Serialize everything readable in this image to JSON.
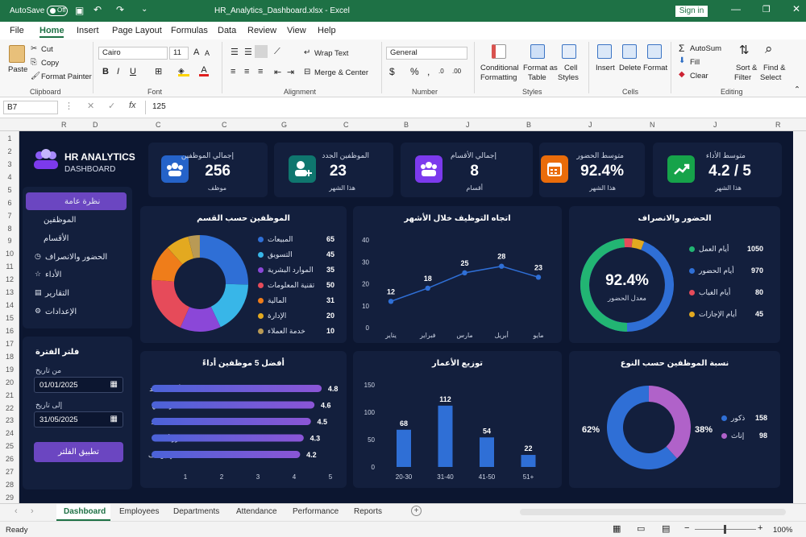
{
  "titlebar": {
    "autosave": "AutoSave",
    "toggle": "Off",
    "title": "HR_Analytics_Dashboard.xlsx  -  Excel",
    "signin": "Sign in"
  },
  "menu": [
    "File",
    "Home",
    "Insert",
    "Page Layout",
    "Formulas",
    "Data",
    "Review",
    "View",
    "Help"
  ],
  "ribbon": {
    "paste": "Paste",
    "cut": "Cut",
    "copy": "Copy",
    "format_painter": "Format Painter",
    "clipboard": "Clipboard",
    "font_name": "Cairo",
    "font_size": "11",
    "font_group": "Font",
    "wrap_text": "Wrap Text",
    "merge_center": "Merge & Center",
    "alignment": "Alignment",
    "number_format": "General",
    "number_group": "Number",
    "conditional_formatting": [
      "Conditional",
      "Formatting"
    ],
    "format_as_table": [
      "Format as",
      "Table"
    ],
    "cell_styles": [
      "Cell",
      "Styles"
    ],
    "styles_group": "Styles",
    "insert": "Insert",
    "delete": "Delete",
    "format": "Format",
    "cells_group": "Cells",
    "autosum": "AutoSum",
    "fill": "Fill",
    "clear": "Clear",
    "sort_filter": [
      "Sort &",
      "Filter"
    ],
    "find_select": [
      "Find &",
      "Select"
    ],
    "editing_group": "Editing"
  },
  "formula_bar": {
    "cell_ref": "B7",
    "fx": "fx",
    "value": "125"
  },
  "columns": [
    "R",
    "D",
    "C",
    "C",
    "G",
    "C",
    "B",
    "J",
    "B",
    "J",
    "N",
    "J",
    "R"
  ],
  "rows": [
    "1",
    "2",
    "3",
    "4",
    "5",
    "6",
    "7",
    "8",
    "9",
    "10",
    "11",
    "12",
    "13",
    "14",
    "15",
    "16",
    "17",
    "18",
    "19",
    "20",
    "21",
    "22",
    "23",
    "24",
    "25",
    "26",
    "27",
    "28",
    "29"
  ],
  "dashboard": {
    "brand_title": "HR ANALYTICS",
    "brand_sub": "DASHBOARD",
    "nav": [
      "نظرة عامة",
      "الموظفين",
      "الأقسام",
      "الحضور والانصراف",
      "الأداء",
      "التقارير",
      "الإعدادات"
    ],
    "filter": {
      "title": "فلتر الفترة",
      "from_label": "من تاريخ",
      "from_value": "01/01/2025",
      "to_label": "إلى تاريخ",
      "to_value": "31/05/2025",
      "apply": "تطبيق الفلتر"
    },
    "kpis": [
      {
        "label": "إجمالي الموظفين",
        "value": "256",
        "sub": "موظف",
        "color": "#2563c9",
        "icon": "users-icon"
      },
      {
        "label": "الموظفين الجدد",
        "value": "23",
        "sub": "هذا الشهر",
        "color": "#0f766e",
        "icon": "user-plus-icon"
      },
      {
        "label": "إجمالي الأقسام",
        "value": "8",
        "sub": "أقسام",
        "color": "#7c3aed",
        "icon": "group-icon"
      },
      {
        "label": "متوسط الحضور",
        "value": "92.4%",
        "sub": "هذا الشهر",
        "color": "#ea6c0a",
        "icon": "calendar-icon"
      },
      {
        "label": "متوسط الأداء",
        "value": "4.2 / 5",
        "sub": "هذا الشهر",
        "color": "#16a34a",
        "icon": "trend-icon"
      }
    ],
    "dept_chart": {
      "title": "الموظفين حسب القسم",
      "items": [
        {
          "name": "المبيعات",
          "value": "65",
          "color": "#2f6fd6"
        },
        {
          "name": "التسويق",
          "value": "45",
          "color": "#38b6e8"
        },
        {
          "name": "الموارد البشرية",
          "value": "35",
          "color": "#8b47d8"
        },
        {
          "name": "تقنية المعلومات",
          "value": "50",
          "color": "#e64b5a"
        },
        {
          "name": "المالية",
          "value": "31",
          "color": "#ef7d1a"
        },
        {
          "name": "الإدارة",
          "value": "20",
          "color": "#e3a920"
        },
        {
          "name": "خدمة العملاء",
          "value": "10",
          "color": "#b99a55"
        }
      ]
    },
    "attendance": {
      "title": "الحضور والانصراف",
      "center_value": "92.4%",
      "center_label": "معدل الحضور",
      "items": [
        {
          "name": "أيام العمل",
          "value": "1050",
          "color": "#22b573"
        },
        {
          "name": "أيام الحضور",
          "value": "970",
          "color": "#2f6fd6"
        },
        {
          "name": "أيام الغياب",
          "value": "80",
          "color": "#e64b5a"
        },
        {
          "name": "أيام الإجازات",
          "value": "45",
          "color": "#e3a920"
        }
      ]
    },
    "gender": {
      "title": "نسبة الموظفين حسب النوع",
      "left_pct": "62%",
      "right_pct": "38%",
      "items": [
        {
          "name": "ذكور",
          "value": "158",
          "color": "#2f6fd6"
        },
        {
          "name": "إناث",
          "value": "98",
          "color": "#b062c9"
        }
      ]
    }
  },
  "chart_data": [
    {
      "type": "pie",
      "title": "الموظفين حسب القسم",
      "categories": [
        "المبيعات",
        "التسويق",
        "الموارد البشرية",
        "تقنية المعلومات",
        "المالية",
        "الإدارة",
        "خدمة العملاء"
      ],
      "values": [
        65,
        45,
        35,
        50,
        31,
        20,
        10
      ]
    },
    {
      "type": "line",
      "title": "اتجاه التوظيف خلال الأشهر",
      "categories": [
        "يناير",
        "فبراير",
        "مارس",
        "أبريل",
        "مايو"
      ],
      "values": [
        12,
        18,
        25,
        28,
        23
      ],
      "yticks": [
        "0",
        "10",
        "20",
        "30",
        "40"
      ],
      "ylim": [
        0,
        40
      ],
      "color": "#2f6fd6"
    },
    {
      "type": "pie",
      "title": "الحضور والانصراف",
      "categories": [
        "أيام العمل",
        "أيام الحضور",
        "أيام الغياب",
        "أيام الإجازات"
      ],
      "values": [
        1050,
        970,
        80,
        45
      ],
      "ring_values": [
        970,
        80,
        45
      ]
    },
    {
      "type": "bar",
      "title": "أفضل 5 موظفين أداءً",
      "categories": [
        "أحمد محمد",
        "سارة علي",
        "محمد خالد",
        "نور أحمد",
        "علي يوسف"
      ],
      "values": [
        4.8,
        4.6,
        4.5,
        4.3,
        4.2
      ],
      "xticks": [
        "1",
        "2",
        "3",
        "4",
        "5"
      ],
      "xlim": [
        1,
        5
      ],
      "orientation": "horizontal"
    },
    {
      "type": "bar",
      "title": "توزيع الأعمار",
      "categories": [
        "20-30",
        "31-40",
        "41-50",
        "51+"
      ],
      "values": [
        68,
        112,
        54,
        22
      ],
      "yticks": [
        "0",
        "50",
        "100",
        "150"
      ],
      "ylim": [
        0,
        150
      ],
      "color": "#2f6fd6"
    },
    {
      "type": "pie",
      "title": "نسبة الموظفين حسب النوع",
      "categories": [
        "ذكور",
        "إناث"
      ],
      "values": [
        158,
        98
      ]
    }
  ],
  "sheet_tabs": [
    "Dashboard",
    "Employees",
    "Departments",
    "Attendance",
    "Performance",
    "Reports"
  ],
  "status": {
    "ready": "Ready",
    "zoom": "100%"
  }
}
